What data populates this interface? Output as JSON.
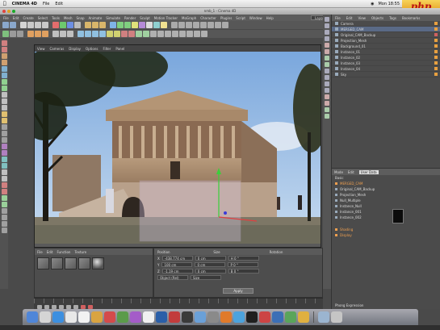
{
  "mac_menubar": {
    "app_name": "CINEMA 4D",
    "items": [
      "File",
      "Edit"
    ],
    "right_text": "Mon 18:55"
  },
  "window": {
    "title": "nmb_1 - Cinema 4D"
  },
  "c4d_menu": {
    "items": [
      "File",
      "Edit",
      "Create",
      "Select",
      "Tools",
      "Mesh",
      "Snap",
      "Animate",
      "Simulate",
      "Render",
      "Sculpt",
      "Motion Tracker",
      "MoGraph",
      "Character",
      "Plugins",
      "Script",
      "Window",
      "Help"
    ],
    "layout_label": "Layout:"
  },
  "viewport": {
    "menu": [
      "View",
      "Cameras",
      "Display",
      "Options",
      "Filter",
      "Panel"
    ]
  },
  "object_manager": {
    "tabs": [
      "File",
      "Edit",
      "View",
      "Objects",
      "Tags",
      "Bookmarks"
    ],
    "objects": [
      "Camera",
      "MERGED_CAM",
      "Original_CAM_Backup",
      "Projection_Mesh",
      "Background_01",
      "Instance_01",
      "Instance_02",
      "Instance_03",
      "Instance_04",
      "Sky"
    ]
  },
  "attribute_manager": {
    "tabs": [
      "Mode",
      "Edit",
      "User Data"
    ],
    "header": "Basic",
    "items": [
      "MERGED_CAM",
      "Original_CAM_Backup",
      "Projection_Mesh",
      "Null_Multiple",
      "Instance_Null",
      "Instance_001",
      "Instance_002"
    ],
    "orange_items": [
      "Shading",
      "Display"
    ],
    "footer": "Phong Expression"
  },
  "material_manager": {
    "menu": [
      "File",
      "Edit",
      "Function",
      "Texture"
    ]
  },
  "coordinates": {
    "headers": [
      "Position",
      "Size",
      "Rotation"
    ],
    "rows": [
      {
        "axis": "X",
        "pos": "-438.774 cm",
        "size": "0 cm",
        "rot": "H 0 °"
      },
      {
        "axis": "Y",
        "pos": "100 cm",
        "size": "0 cm",
        "rot": "P 0 °"
      },
      {
        "axis": "Z",
        "pos": "-1.19 cm",
        "size": "0 cm",
        "rot": "B 0 °"
      }
    ],
    "mode_label": "Object (Rel)",
    "size_mode": "Size",
    "apply_label": "Apply"
  },
  "colors": {
    "accent_select": "#5a6a86",
    "watermark_bg": "#f0b534",
    "watermark_text": "#bb1111"
  },
  "watermark": {
    "text": "php"
  }
}
